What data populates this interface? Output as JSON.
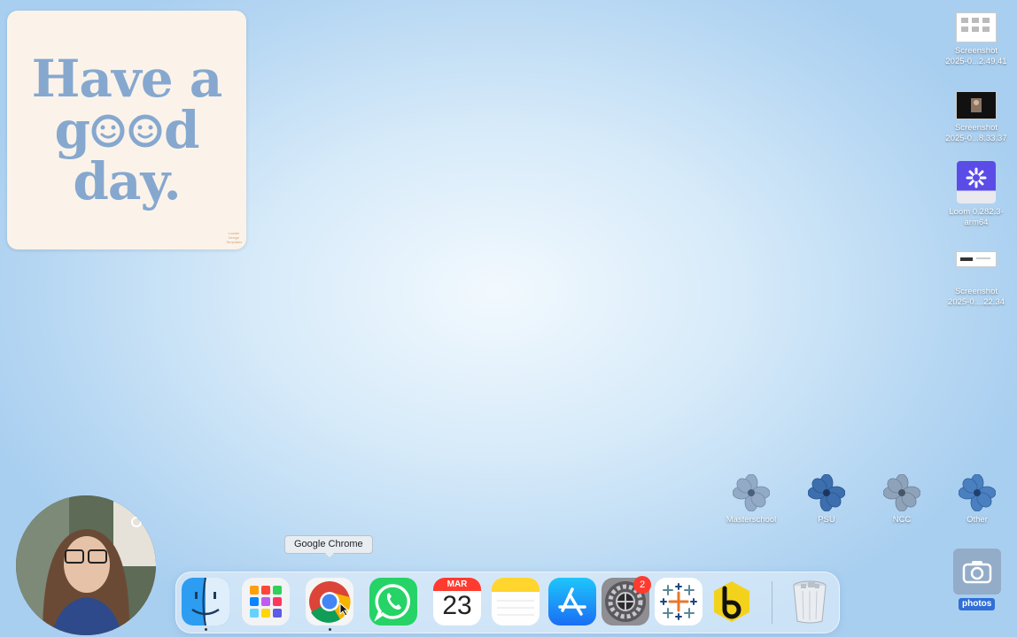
{
  "widget": {
    "line1": "Have a",
    "line2_start": "g",
    "line2_end": "d",
    "line3": "day.",
    "credit": "Lowder Design Templates"
  },
  "desktop_icons": [
    {
      "label_line1": "Screenshot",
      "label_line2": "2025-0...2.49.41",
      "icon": "screenshot-thumbnail-icon"
    },
    {
      "label_line1": "Screenshot",
      "label_line2": "2025-0...8.33.37",
      "icon": "screenshot-thumbnail-icon"
    },
    {
      "label_line1": "Loom 0.282.3-",
      "label_line2": "arm64",
      "icon": "loom-installer-icon"
    },
    {
      "label_line1": "Screenshot",
      "label_line2": "2025-0....22.34",
      "icon": "screenshot-thumbnail-icon"
    }
  ],
  "folders": [
    {
      "label": "Masterschool",
      "icon": "flower-folder-icon",
      "color": "#8fa7c4"
    },
    {
      "label": "PSU",
      "icon": "flower-folder-icon",
      "color": "#3d6fae"
    },
    {
      "label": "NCC",
      "icon": "flower-folder-icon",
      "color": "#8aa0b8"
    },
    {
      "label": "Other",
      "icon": "flower-folder-icon",
      "color": "#4a7fc0"
    }
  ],
  "tooltip": "Google Chrome",
  "dock": {
    "apps": [
      {
        "name": "Finder",
        "icon": "finder-icon"
      },
      {
        "name": "Launchpad",
        "icon": "launchpad-icon"
      },
      {
        "name": "Google Chrome",
        "icon": "chrome-icon"
      },
      {
        "name": "WhatsApp",
        "icon": "whatsapp-icon"
      },
      {
        "name": "Calendar",
        "icon": "calendar-icon",
        "month": "MAR",
        "day": "23"
      },
      {
        "name": "Notes",
        "icon": "notes-icon"
      },
      {
        "name": "App Store",
        "icon": "app-store-icon"
      },
      {
        "name": "System Settings",
        "icon": "gear-icon",
        "badge": "2"
      },
      {
        "name": "Tableau",
        "icon": "tableau-icon"
      },
      {
        "name": "Beeper",
        "icon": "beeper-icon"
      },
      {
        "name": "Trash",
        "icon": "trash-icon"
      }
    ]
  },
  "photos_folder": {
    "label": "photos",
    "icon": "camera-icon"
  },
  "colors": {
    "accent": "#2f6fd6",
    "widget_text": "#86a8cf",
    "badge": "#ff3b30"
  }
}
